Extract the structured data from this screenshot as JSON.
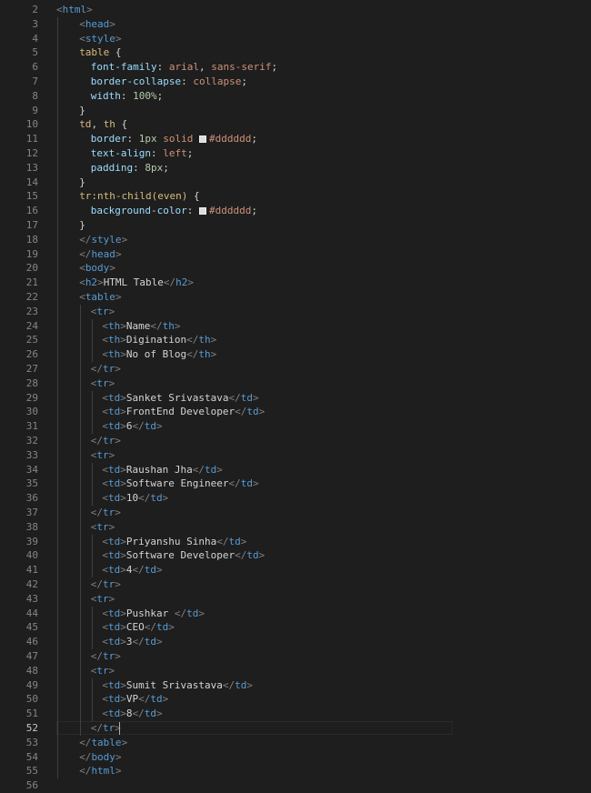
{
  "editor": {
    "first_line_number": 2,
    "active_line": 52,
    "swatch_color": "#dddddd",
    "lines": [
      {
        "indent": 0,
        "tokens": [
          [
            "punct",
            "<"
          ],
          [
            "tag",
            "html"
          ],
          [
            "punct",
            ">"
          ]
        ]
      },
      {
        "indent": 2,
        "tokens": [
          [
            "punct",
            "<"
          ],
          [
            "tag",
            "head"
          ],
          [
            "punct",
            ">"
          ]
        ]
      },
      {
        "indent": 2,
        "tokens": [
          [
            "punct",
            "<"
          ],
          [
            "tag",
            "style"
          ],
          [
            "punct",
            ">"
          ]
        ]
      },
      {
        "indent": 2,
        "tokens": [
          [
            "sel",
            "table"
          ],
          [
            "plain",
            " {"
          ]
        ]
      },
      {
        "indent": 3,
        "tokens": [
          [
            "prop",
            "font-family"
          ],
          [
            "plain",
            ": "
          ],
          [
            "val",
            "arial"
          ],
          [
            "plain",
            ", "
          ],
          [
            "val",
            "sans-serif"
          ],
          [
            "plain",
            ";"
          ]
        ]
      },
      {
        "indent": 3,
        "tokens": [
          [
            "prop",
            "border-collapse"
          ],
          [
            "plain",
            ": "
          ],
          [
            "val",
            "collapse"
          ],
          [
            "plain",
            ";"
          ]
        ]
      },
      {
        "indent": 3,
        "tokens": [
          [
            "prop",
            "width"
          ],
          [
            "plain",
            ": "
          ],
          [
            "num",
            "100%"
          ],
          [
            "plain",
            ";"
          ]
        ]
      },
      {
        "indent": 2,
        "tokens": [
          [
            "plain",
            "}"
          ]
        ]
      },
      {
        "indent": 2,
        "tokens": [
          [
            "sel",
            "td"
          ],
          [
            "plain",
            ", "
          ],
          [
            "sel",
            "th"
          ],
          [
            "plain",
            " {"
          ]
        ]
      },
      {
        "indent": 3,
        "tokens": [
          [
            "prop",
            "border"
          ],
          [
            "plain",
            ": "
          ],
          [
            "num",
            "1px"
          ],
          [
            "plain",
            " "
          ],
          [
            "val",
            "solid"
          ],
          [
            "plain",
            " "
          ],
          [
            "swatch",
            ""
          ],
          [
            "val",
            "#dddddd"
          ],
          [
            "plain",
            ";"
          ]
        ]
      },
      {
        "indent": 3,
        "tokens": [
          [
            "prop",
            "text-align"
          ],
          [
            "plain",
            ": "
          ],
          [
            "val",
            "left"
          ],
          [
            "plain",
            ";"
          ]
        ]
      },
      {
        "indent": 3,
        "tokens": [
          [
            "prop",
            "padding"
          ],
          [
            "plain",
            ": "
          ],
          [
            "num",
            "8px"
          ],
          [
            "plain",
            ";"
          ]
        ]
      },
      {
        "indent": 2,
        "tokens": [
          [
            "plain",
            "}"
          ]
        ]
      },
      {
        "indent": 2,
        "tokens": [
          [
            "sel",
            "tr:nth-child(even)"
          ],
          [
            "plain",
            " {"
          ]
        ]
      },
      {
        "indent": 3,
        "tokens": [
          [
            "prop",
            "background-color"
          ],
          [
            "plain",
            ": "
          ],
          [
            "swatch",
            ""
          ],
          [
            "val",
            "#dddddd"
          ],
          [
            "plain",
            ";"
          ]
        ]
      },
      {
        "indent": 2,
        "tokens": [
          [
            "plain",
            "}"
          ]
        ]
      },
      {
        "indent": 2,
        "tokens": [
          [
            "punct",
            "</"
          ],
          [
            "tag",
            "style"
          ],
          [
            "punct",
            ">"
          ]
        ]
      },
      {
        "indent": 2,
        "tokens": [
          [
            "punct",
            "</"
          ],
          [
            "tag",
            "head"
          ],
          [
            "punct",
            ">"
          ]
        ]
      },
      {
        "indent": 2,
        "tokens": [
          [
            "punct",
            "<"
          ],
          [
            "tag",
            "body"
          ],
          [
            "punct",
            ">"
          ]
        ]
      },
      {
        "indent": 2,
        "tokens": [
          [
            "punct",
            "<"
          ],
          [
            "tag",
            "h2"
          ],
          [
            "punct",
            ">"
          ],
          [
            "text",
            "HTML Table"
          ],
          [
            "punct",
            "</"
          ],
          [
            "tag",
            "h2"
          ],
          [
            "punct",
            ">"
          ]
        ]
      },
      {
        "indent": 2,
        "tokens": [
          [
            "punct",
            "<"
          ],
          [
            "tag",
            "table"
          ],
          [
            "punct",
            ">"
          ]
        ]
      },
      {
        "indent": 3,
        "tokens": [
          [
            "punct",
            "<"
          ],
          [
            "tag",
            "tr"
          ],
          [
            "punct",
            ">"
          ]
        ]
      },
      {
        "indent": 4,
        "tokens": [
          [
            "punct",
            "<"
          ],
          [
            "tag",
            "th"
          ],
          [
            "punct",
            ">"
          ],
          [
            "text",
            "Name"
          ],
          [
            "punct",
            "</"
          ],
          [
            "tag",
            "th"
          ],
          [
            "punct",
            ">"
          ]
        ]
      },
      {
        "indent": 4,
        "tokens": [
          [
            "punct",
            "<"
          ],
          [
            "tag",
            "th"
          ],
          [
            "punct",
            ">"
          ],
          [
            "text",
            "Digination"
          ],
          [
            "punct",
            "</"
          ],
          [
            "tag",
            "th"
          ],
          [
            "punct",
            ">"
          ]
        ]
      },
      {
        "indent": 4,
        "tokens": [
          [
            "punct",
            "<"
          ],
          [
            "tag",
            "th"
          ],
          [
            "punct",
            ">"
          ],
          [
            "text",
            "No of Blog"
          ],
          [
            "punct",
            "</"
          ],
          [
            "tag",
            "th"
          ],
          [
            "punct",
            ">"
          ]
        ]
      },
      {
        "indent": 3,
        "tokens": [
          [
            "punct",
            "</"
          ],
          [
            "tag",
            "tr"
          ],
          [
            "punct",
            ">"
          ]
        ]
      },
      {
        "indent": 3,
        "tokens": [
          [
            "punct",
            "<"
          ],
          [
            "tag",
            "tr"
          ],
          [
            "punct",
            ">"
          ]
        ]
      },
      {
        "indent": 4,
        "tokens": [
          [
            "punct",
            "<"
          ],
          [
            "tag",
            "td"
          ],
          [
            "punct",
            ">"
          ],
          [
            "text",
            "Sanket Srivastava"
          ],
          [
            "punct",
            "</"
          ],
          [
            "tag",
            "td"
          ],
          [
            "punct",
            ">"
          ]
        ]
      },
      {
        "indent": 4,
        "tokens": [
          [
            "punct",
            "<"
          ],
          [
            "tag",
            "td"
          ],
          [
            "punct",
            ">"
          ],
          [
            "text",
            "FrontEnd Developer"
          ],
          [
            "punct",
            "</"
          ],
          [
            "tag",
            "td"
          ],
          [
            "punct",
            ">"
          ]
        ]
      },
      {
        "indent": 4,
        "tokens": [
          [
            "punct",
            "<"
          ],
          [
            "tag",
            "td"
          ],
          [
            "punct",
            ">"
          ],
          [
            "text",
            "6"
          ],
          [
            "punct",
            "</"
          ],
          [
            "tag",
            "td"
          ],
          [
            "punct",
            ">"
          ]
        ]
      },
      {
        "indent": 3,
        "tokens": [
          [
            "punct",
            "</"
          ],
          [
            "tag",
            "tr"
          ],
          [
            "punct",
            ">"
          ]
        ]
      },
      {
        "indent": 3,
        "tokens": [
          [
            "punct",
            "<"
          ],
          [
            "tag",
            "tr"
          ],
          [
            "punct",
            ">"
          ]
        ]
      },
      {
        "indent": 4,
        "tokens": [
          [
            "punct",
            "<"
          ],
          [
            "tag",
            "td"
          ],
          [
            "punct",
            ">"
          ],
          [
            "text",
            "Raushan Jha"
          ],
          [
            "punct",
            "</"
          ],
          [
            "tag",
            "td"
          ],
          [
            "punct",
            ">"
          ]
        ]
      },
      {
        "indent": 4,
        "tokens": [
          [
            "punct",
            "<"
          ],
          [
            "tag",
            "td"
          ],
          [
            "punct",
            ">"
          ],
          [
            "text",
            "Software Engineer"
          ],
          [
            "punct",
            "</"
          ],
          [
            "tag",
            "td"
          ],
          [
            "punct",
            ">"
          ]
        ]
      },
      {
        "indent": 4,
        "tokens": [
          [
            "punct",
            "<"
          ],
          [
            "tag",
            "td"
          ],
          [
            "punct",
            ">"
          ],
          [
            "text",
            "10"
          ],
          [
            "punct",
            "</"
          ],
          [
            "tag",
            "td"
          ],
          [
            "punct",
            ">"
          ]
        ]
      },
      {
        "indent": 3,
        "tokens": [
          [
            "punct",
            "</"
          ],
          [
            "tag",
            "tr"
          ],
          [
            "punct",
            ">"
          ]
        ]
      },
      {
        "indent": 3,
        "tokens": [
          [
            "punct",
            "<"
          ],
          [
            "tag",
            "tr"
          ],
          [
            "punct",
            ">"
          ]
        ]
      },
      {
        "indent": 4,
        "tokens": [
          [
            "punct",
            "<"
          ],
          [
            "tag",
            "td"
          ],
          [
            "punct",
            ">"
          ],
          [
            "text",
            "Priyanshu Sinha"
          ],
          [
            "punct",
            "</"
          ],
          [
            "tag",
            "td"
          ],
          [
            "punct",
            ">"
          ]
        ]
      },
      {
        "indent": 4,
        "tokens": [
          [
            "punct",
            "<"
          ],
          [
            "tag",
            "td"
          ],
          [
            "punct",
            ">"
          ],
          [
            "text",
            "Software Developer"
          ],
          [
            "punct",
            "</"
          ],
          [
            "tag",
            "td"
          ],
          [
            "punct",
            ">"
          ]
        ]
      },
      {
        "indent": 4,
        "tokens": [
          [
            "punct",
            "<"
          ],
          [
            "tag",
            "td"
          ],
          [
            "punct",
            ">"
          ],
          [
            "text",
            "4"
          ],
          [
            "punct",
            "</"
          ],
          [
            "tag",
            "td"
          ],
          [
            "punct",
            ">"
          ]
        ]
      },
      {
        "indent": 3,
        "tokens": [
          [
            "punct",
            "</"
          ],
          [
            "tag",
            "tr"
          ],
          [
            "punct",
            ">"
          ]
        ]
      },
      {
        "indent": 3,
        "tokens": [
          [
            "punct",
            "<"
          ],
          [
            "tag",
            "tr"
          ],
          [
            "punct",
            ">"
          ]
        ]
      },
      {
        "indent": 4,
        "tokens": [
          [
            "punct",
            "<"
          ],
          [
            "tag",
            "td"
          ],
          [
            "punct",
            ">"
          ],
          [
            "text",
            "Pushkar "
          ],
          [
            "punct",
            "</"
          ],
          [
            "tag",
            "td"
          ],
          [
            "punct",
            ">"
          ]
        ]
      },
      {
        "indent": 4,
        "tokens": [
          [
            "punct",
            "<"
          ],
          [
            "tag",
            "td"
          ],
          [
            "punct",
            ">"
          ],
          [
            "text",
            "CEO"
          ],
          [
            "punct",
            "</"
          ],
          [
            "tag",
            "td"
          ],
          [
            "punct",
            ">"
          ]
        ]
      },
      {
        "indent": 4,
        "tokens": [
          [
            "punct",
            "<"
          ],
          [
            "tag",
            "td"
          ],
          [
            "punct",
            ">"
          ],
          [
            "text",
            "3"
          ],
          [
            "punct",
            "</"
          ],
          [
            "tag",
            "td"
          ],
          [
            "punct",
            ">"
          ]
        ]
      },
      {
        "indent": 3,
        "tokens": [
          [
            "punct",
            "</"
          ],
          [
            "tag",
            "tr"
          ],
          [
            "punct",
            ">"
          ]
        ]
      },
      {
        "indent": 3,
        "tokens": [
          [
            "punct",
            "<"
          ],
          [
            "tag",
            "tr"
          ],
          [
            "punct",
            ">"
          ]
        ]
      },
      {
        "indent": 4,
        "tokens": [
          [
            "punct",
            "<"
          ],
          [
            "tag",
            "td"
          ],
          [
            "punct",
            ">"
          ],
          [
            "text",
            "Sumit Srivastava"
          ],
          [
            "punct",
            "</"
          ],
          [
            "tag",
            "td"
          ],
          [
            "punct",
            ">"
          ]
        ]
      },
      {
        "indent": 4,
        "tokens": [
          [
            "punct",
            "<"
          ],
          [
            "tag",
            "td"
          ],
          [
            "punct",
            ">"
          ],
          [
            "text",
            "VP"
          ],
          [
            "punct",
            "</"
          ],
          [
            "tag",
            "td"
          ],
          [
            "punct",
            ">"
          ]
        ]
      },
      {
        "indent": 4,
        "tokens": [
          [
            "punct",
            "<"
          ],
          [
            "tag",
            "td"
          ],
          [
            "punct",
            ">"
          ],
          [
            "text",
            "8"
          ],
          [
            "punct",
            "</"
          ],
          [
            "tag",
            "td"
          ],
          [
            "punct",
            ">"
          ]
        ]
      },
      {
        "indent": 3,
        "tokens": [
          [
            "punct",
            "</"
          ],
          [
            "tag",
            "tr"
          ],
          [
            "punct",
            ">"
          ]
        ]
      },
      {
        "indent": 2,
        "tokens": [
          [
            "punct",
            "</"
          ],
          [
            "tag",
            "table"
          ],
          [
            "punct",
            ">"
          ]
        ]
      },
      {
        "indent": 2,
        "tokens": [
          [
            "punct",
            "</"
          ],
          [
            "tag",
            "body"
          ],
          [
            "punct",
            ">"
          ]
        ]
      },
      {
        "indent": 2,
        "tokens": [
          [
            "punct",
            "</"
          ],
          [
            "tag",
            "html"
          ],
          [
            "punct",
            ">"
          ]
        ]
      },
      {
        "indent": 0,
        "tokens": []
      }
    ]
  }
}
